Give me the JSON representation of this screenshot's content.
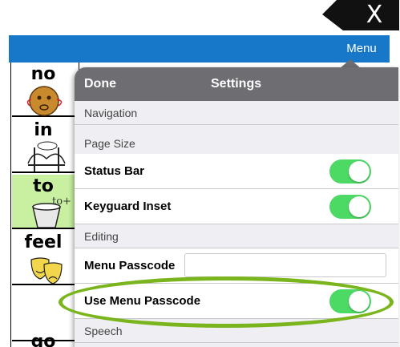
{
  "header": {
    "close_key_label": "X",
    "menu_label": "Menu",
    "bar_color": "#1778c9"
  },
  "board": {
    "cells": [
      {
        "word": "no",
        "sub": "",
        "picture": "face-no-icon",
        "highlight": false
      },
      {
        "word": "in",
        "sub": "",
        "picture": "bridge-icon",
        "highlight": false
      },
      {
        "word": "to",
        "sub": "to+",
        "picture": "bucket-icon",
        "highlight": true
      },
      {
        "word": "feel",
        "sub": "",
        "picture": "theater-masks-icon",
        "highlight": false
      },
      {
        "word": "go",
        "sub": "",
        "picture": "",
        "highlight": false
      }
    ]
  },
  "settings": {
    "done_label": "Done",
    "title": "Settings",
    "sections": {
      "navigation": "Navigation",
      "page_size": "Page Size",
      "editing": "Editing",
      "speech": "Speech"
    },
    "rows": {
      "status_bar": {
        "label": "Status Bar",
        "on": true
      },
      "keyguard_inset": {
        "label": "Keyguard Inset",
        "on": true
      },
      "menu_passcode": {
        "label": "Menu Passcode",
        "value": "",
        "placeholder": ""
      },
      "use_menu_passcode": {
        "label": "Use Menu Passcode",
        "on": true
      }
    },
    "toggle_on_color": "#4cd964",
    "highlight_color": "#7ab51d"
  }
}
